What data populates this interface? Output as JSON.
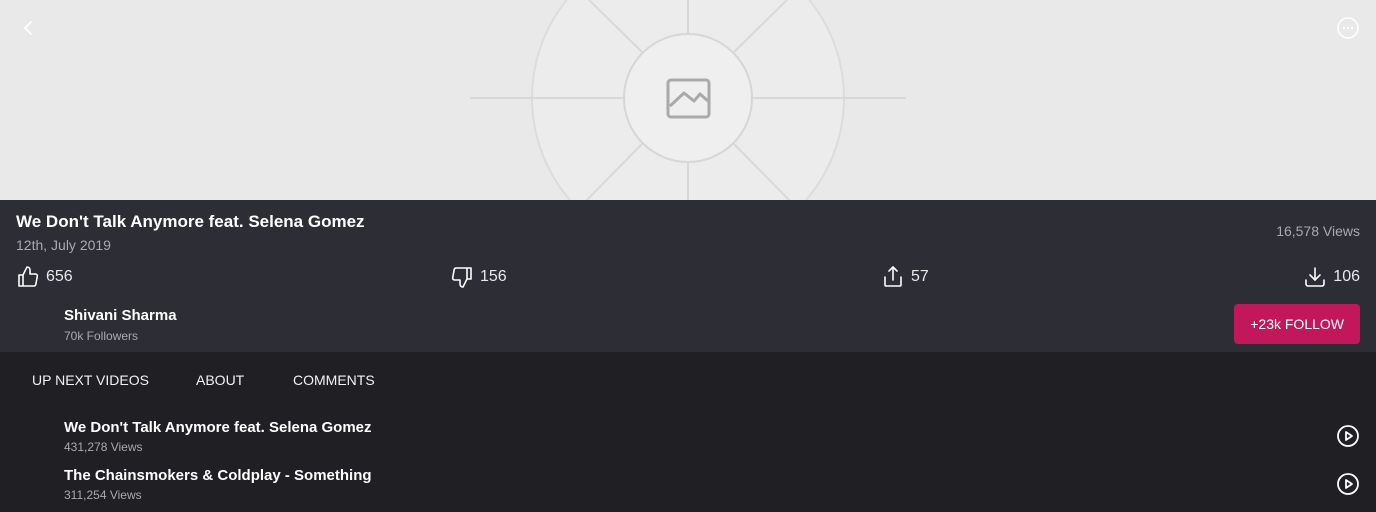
{
  "video": {
    "title": "We Don't Talk Anymore feat. Selena Gomez",
    "date": "12th, July 2019",
    "views": "16,578 Views"
  },
  "stats": {
    "likes": "656",
    "dislikes": "156",
    "shares": "57",
    "downloads": "106"
  },
  "channel": {
    "name": "Shivani Sharma",
    "followers": "70k Followers",
    "follow_label": "+23k FOLLOW"
  },
  "tabs": [
    {
      "label": "UP NEXT VIDEOS"
    },
    {
      "label": "ABOUT"
    },
    {
      "label": "COMMENTS"
    }
  ],
  "up_next": [
    {
      "title": "We Don't Talk Anymore feat. Selena Gomez",
      "views": "431,278 Views"
    },
    {
      "title": "The Chainsmokers & Coldplay - Something",
      "views": "311,254 Views"
    }
  ],
  "colors": {
    "accent": "#c2185b",
    "info_bg": "#2c2d35",
    "page_bg": "#1f1f24",
    "hero_bg": "#e9e9e9"
  },
  "icons": {
    "back": "chevron-left-icon",
    "more": "more-horizontal-circle-icon",
    "like": "thumbs-up-icon",
    "dislike": "thumbs-down-icon",
    "share": "share-icon",
    "download": "download-icon",
    "play": "play-circle-icon",
    "placeholder": "image-placeholder-icon"
  }
}
